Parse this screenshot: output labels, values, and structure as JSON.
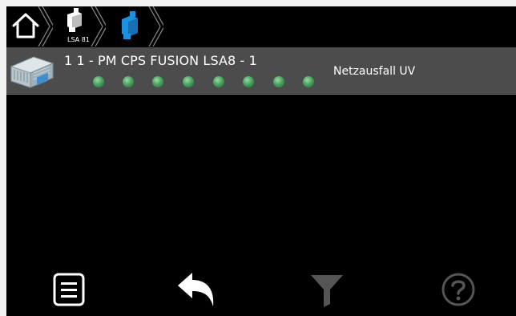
{
  "breadcrumb": {
    "items": [
      {
        "label": ""
      },
      {
        "label": "LSA 81"
      },
      {
        "label": ""
      }
    ]
  },
  "list": {
    "rows": [
      {
        "title": "1 1 - PM CPS FUSION LSA8 - 1",
        "status": "Netzausfall UV",
        "led_count": 8,
        "led_color": "#4aa361"
      }
    ]
  },
  "toolbar": {
    "buttons": [
      {
        "name": "list",
        "enabled": true
      },
      {
        "name": "back",
        "enabled": true
      },
      {
        "name": "filter",
        "enabled": false
      },
      {
        "name": "help",
        "enabled": false
      }
    ]
  },
  "colors": {
    "background": "#000000",
    "row_bg": "#4c4c4c",
    "accent_blue": "#1e90e0",
    "disabled": "#555555"
  }
}
